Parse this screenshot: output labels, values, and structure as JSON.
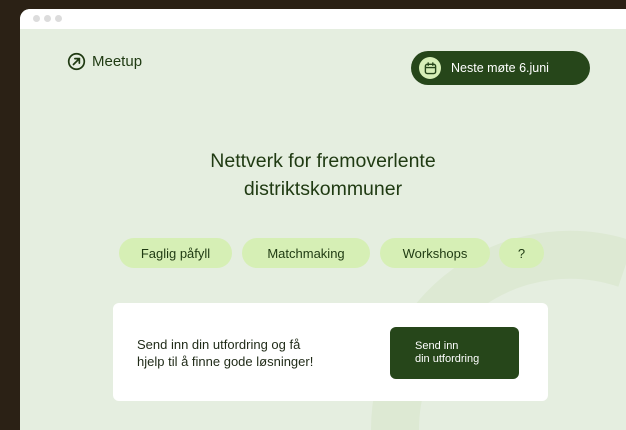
{
  "brand": {
    "name": "Meetup",
    "icon": "arrow-up-right-circle-icon"
  },
  "header": {
    "next_meeting_label": "Neste møte 6.juni",
    "next_meeting_icon": "calendar-icon"
  },
  "hero": {
    "title_line1": "Nettverk for fremoverlente",
    "title_line2": "distriktskommuner"
  },
  "chips": [
    {
      "label": "Faglig påfyll"
    },
    {
      "label": "Matchmaking"
    },
    {
      "label": "Workshops"
    },
    {
      "label": "?"
    }
  ],
  "cta_card": {
    "text_line1": "Send inn din utfordring og få",
    "text_line2": "hjelp til å finne gode løsninger!",
    "button_line1": "Send inn",
    "button_line2": "din utfordring"
  },
  "colors": {
    "page_background": "#e5eee0",
    "outer_frame": "#2b2115",
    "primary_dark_green": "#26461a",
    "chip_light_green": "#d6efb5",
    "text_dark_green": "#1f3a12"
  }
}
